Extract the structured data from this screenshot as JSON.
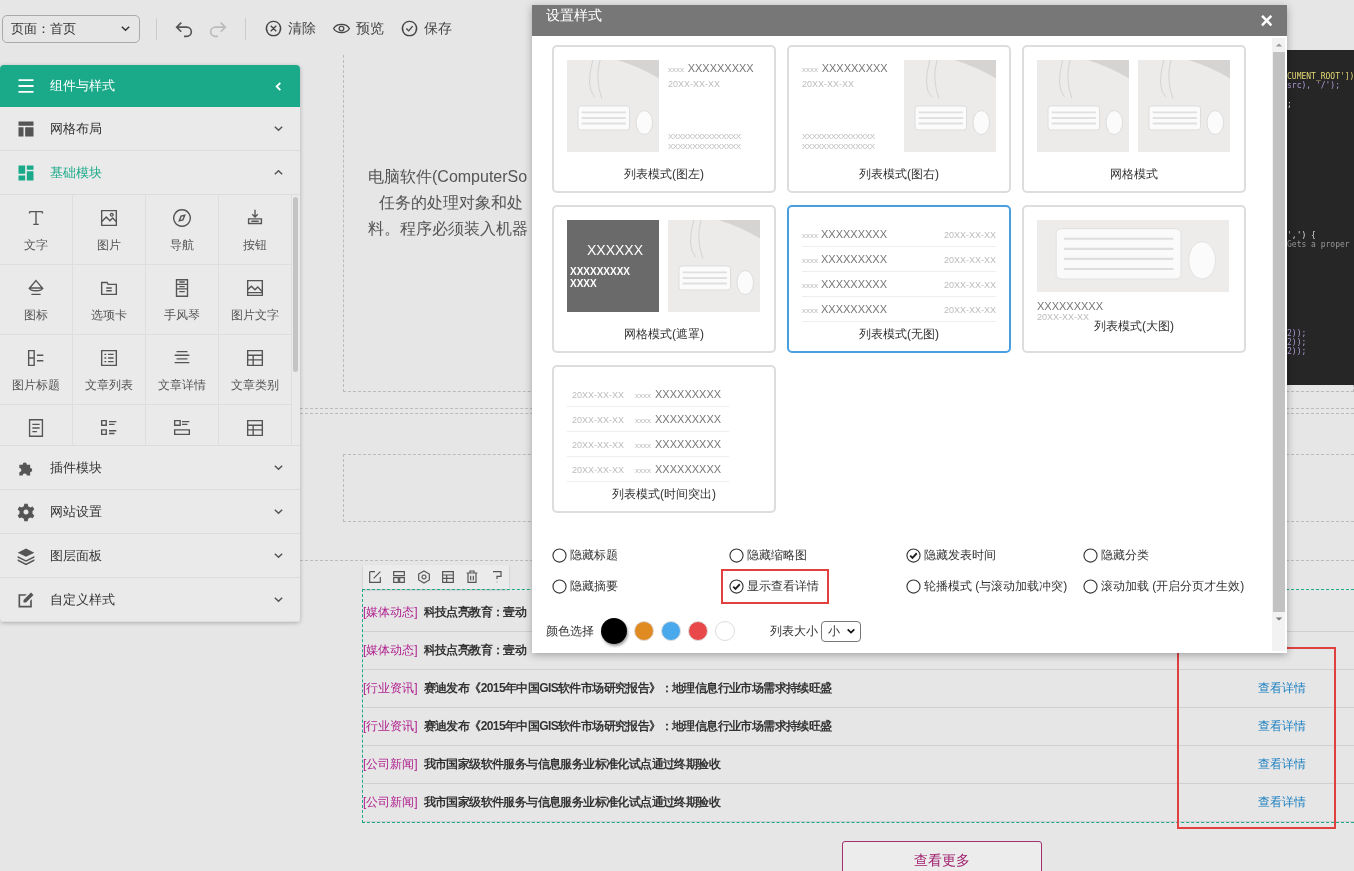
{
  "toolbar": {
    "page_select": "页面：首页",
    "undo": {
      "disabled": false
    },
    "redo": {
      "disabled": true
    },
    "actions": [
      {
        "label": "清除",
        "kind": "clear"
      },
      {
        "label": "预览",
        "kind": "preview"
      },
      {
        "label": "保存",
        "kind": "save"
      }
    ]
  },
  "panel": {
    "title": "组件与样式",
    "sections": [
      {
        "label": "网格布局",
        "expanded": false
      },
      {
        "label": "基础模块",
        "expanded": true,
        "items": [
          {
            "kind": "labeled",
            "label": "文字"
          },
          {
            "kind": "labeled",
            "label": "图片"
          },
          {
            "kind": "labeled",
            "label": "导航"
          },
          {
            "kind": "labeled",
            "label": "按钮"
          },
          {
            "kind": "labeled",
            "label": "图标"
          },
          {
            "kind": "labeled",
            "label": "选项卡"
          },
          {
            "kind": "labeled",
            "label": "手风琴"
          },
          {
            "kind": "labeled",
            "label": "图片文字"
          },
          {
            "kind": "labeled",
            "label": "图片标题"
          },
          {
            "kind": "labeled",
            "label": "文章列表"
          },
          {
            "kind": "labeled",
            "label": "文章详情"
          },
          {
            "kind": "labeled",
            "label": "文章类别"
          },
          {
            "kind": "icon"
          },
          {
            "kind": "icon"
          },
          {
            "kind": "icon"
          },
          {
            "kind": "icon"
          }
        ]
      },
      {
        "label": "插件模块",
        "expanded": false
      },
      {
        "label": "网站设置",
        "expanded": false
      },
      {
        "label": "图层面板",
        "expanded": false
      },
      {
        "label": "自定义样式",
        "expanded": false
      }
    ]
  },
  "canvas": {
    "intro_lines": [
      "电脑软件(ComputerSo",
      "任务的处理对象和处",
      "料。程序必须装入机器"
    ],
    "code_lines": [
      "CUMENT_ROOT'])",
      "src), '/');",
      ";",
      "',') {",
      "Gets a proper",
      "2));",
      "2));",
      "2));"
    ],
    "news_list": {
      "links_highlighted": true,
      "rows": [
        {
          "category": "[媒体动态]",
          "title": "科技点亮教育：壹动"
        },
        {
          "category": "[媒体动态]",
          "title": "科技点亮教育：壹动"
        },
        {
          "category": "[行业资讯]",
          "title": "赛迪发布《2015年中国GIS软件市场研究报告》：地理信息行业市场需求持续旺盛",
          "link": "查看详情"
        },
        {
          "category": "[行业资讯]",
          "title": "赛迪发布《2015年中国GIS软件市场研究报告》：地理信息行业市场需求持续旺盛",
          "link": "查看详情"
        },
        {
          "category": "[公司新闻]",
          "title": "我市国家级软件服务与信息服务业标准化试点通过终期验收",
          "link": "查看详情"
        },
        {
          "category": "[公司新闻]",
          "title": "我市国家级软件服务与信息服务业标准化试点通过终期验收",
          "link": "查看详情"
        }
      ]
    },
    "more_button": "查看更多"
  },
  "dialog": {
    "title": "设置样式",
    "close": "×",
    "styles": [
      {
        "label": "列表模式(图左)",
        "kind": "image-left",
        "selected": false,
        "prefix": "xxxx",
        "title": "XXXXXXXXX",
        "date": "20XX-XX-XX",
        "summary": [
          "XXXXXXXXXXXXXXX",
          "XXXXXXXXXXXXXXX"
        ]
      },
      {
        "label": "列表模式(图右)",
        "kind": "image-right",
        "selected": false,
        "prefix": "xxxx",
        "title": "XXXXXXXXX",
        "date": "20XX-XX-XX",
        "summary": [
          "XXXXXXXXXXXXXXX",
          "XXXXXXXXXXXXXXX"
        ]
      },
      {
        "label": "网格模式",
        "kind": "grid",
        "selected": false
      },
      {
        "label": "网格模式(遮罩)",
        "kind": "grid-mask",
        "selected": false,
        "title": "XXXXXX",
        "summary": [
          "XXXXXXXXX",
          "XXXX"
        ]
      },
      {
        "label": "列表模式(无图)",
        "kind": "list-plain",
        "selected": true,
        "rows": [
          {
            "prefix": "xxxx",
            "title": "XXXXXXXXX",
            "date": "20XX-XX-XX"
          },
          {
            "prefix": "xxxx",
            "title": "XXXXXXXXX",
            "date": "20XX-XX-XX"
          },
          {
            "prefix": "xxxx",
            "title": "XXXXXXXXX",
            "date": "20XX-XX-XX"
          },
          {
            "prefix": "xxxx",
            "title": "XXXXXXXXX",
            "date": "20XX-XX-XX"
          }
        ]
      },
      {
        "label": "列表模式(大图)",
        "kind": "big-image",
        "selected": false,
        "title": "XXXXXXXXX",
        "date": "20XX-XX-XX"
      },
      {
        "label": "列表模式(时间突出)",
        "kind": "time-first",
        "selected": false,
        "rows": [
          {
            "prefix": "xxxx",
            "title": "XXXXXXXXX",
            "date": "20XX-XX-XX"
          },
          {
            "prefix": "xxxx",
            "title": "XXXXXXXXX",
            "date": "20XX-XX-XX"
          },
          {
            "prefix": "xxxx",
            "title": "XXXXXXXXX",
            "date": "20XX-XX-XX"
          },
          {
            "prefix": "xxxx",
            "title": "XXXXXXXXX",
            "date": "20XX-XX-XX"
          }
        ]
      }
    ],
    "options": [
      {
        "label": "隐藏标题",
        "checked": false,
        "highlighted": false
      },
      {
        "label": "隐藏缩略图",
        "checked": false,
        "highlighted": false
      },
      {
        "label": "隐藏发表时间",
        "checked": true,
        "highlighted": false
      },
      {
        "label": "隐藏分类",
        "checked": false,
        "highlighted": false
      },
      {
        "label": "隐藏摘要",
        "checked": false,
        "highlighted": false
      },
      {
        "label": "显示查看详情",
        "checked": true,
        "highlighted": true
      },
      {
        "label": "轮播模式 (与滚动加载冲突)",
        "checked": false,
        "highlighted": false
      },
      {
        "label": "滚动加载 (开启分页才生效)",
        "checked": false,
        "highlighted": false
      }
    ],
    "color_label": "颜色选择",
    "colors": [
      {
        "color": "#000000",
        "selected": true
      },
      {
        "color": "#e08a22",
        "selected": false
      },
      {
        "color": "#4aa8ec",
        "selected": false
      },
      {
        "color": "#e8484a",
        "selected": false
      },
      {
        "color": "#ffffff",
        "selected": false
      }
    ],
    "size_label": "列表大小",
    "size_value": "小"
  }
}
